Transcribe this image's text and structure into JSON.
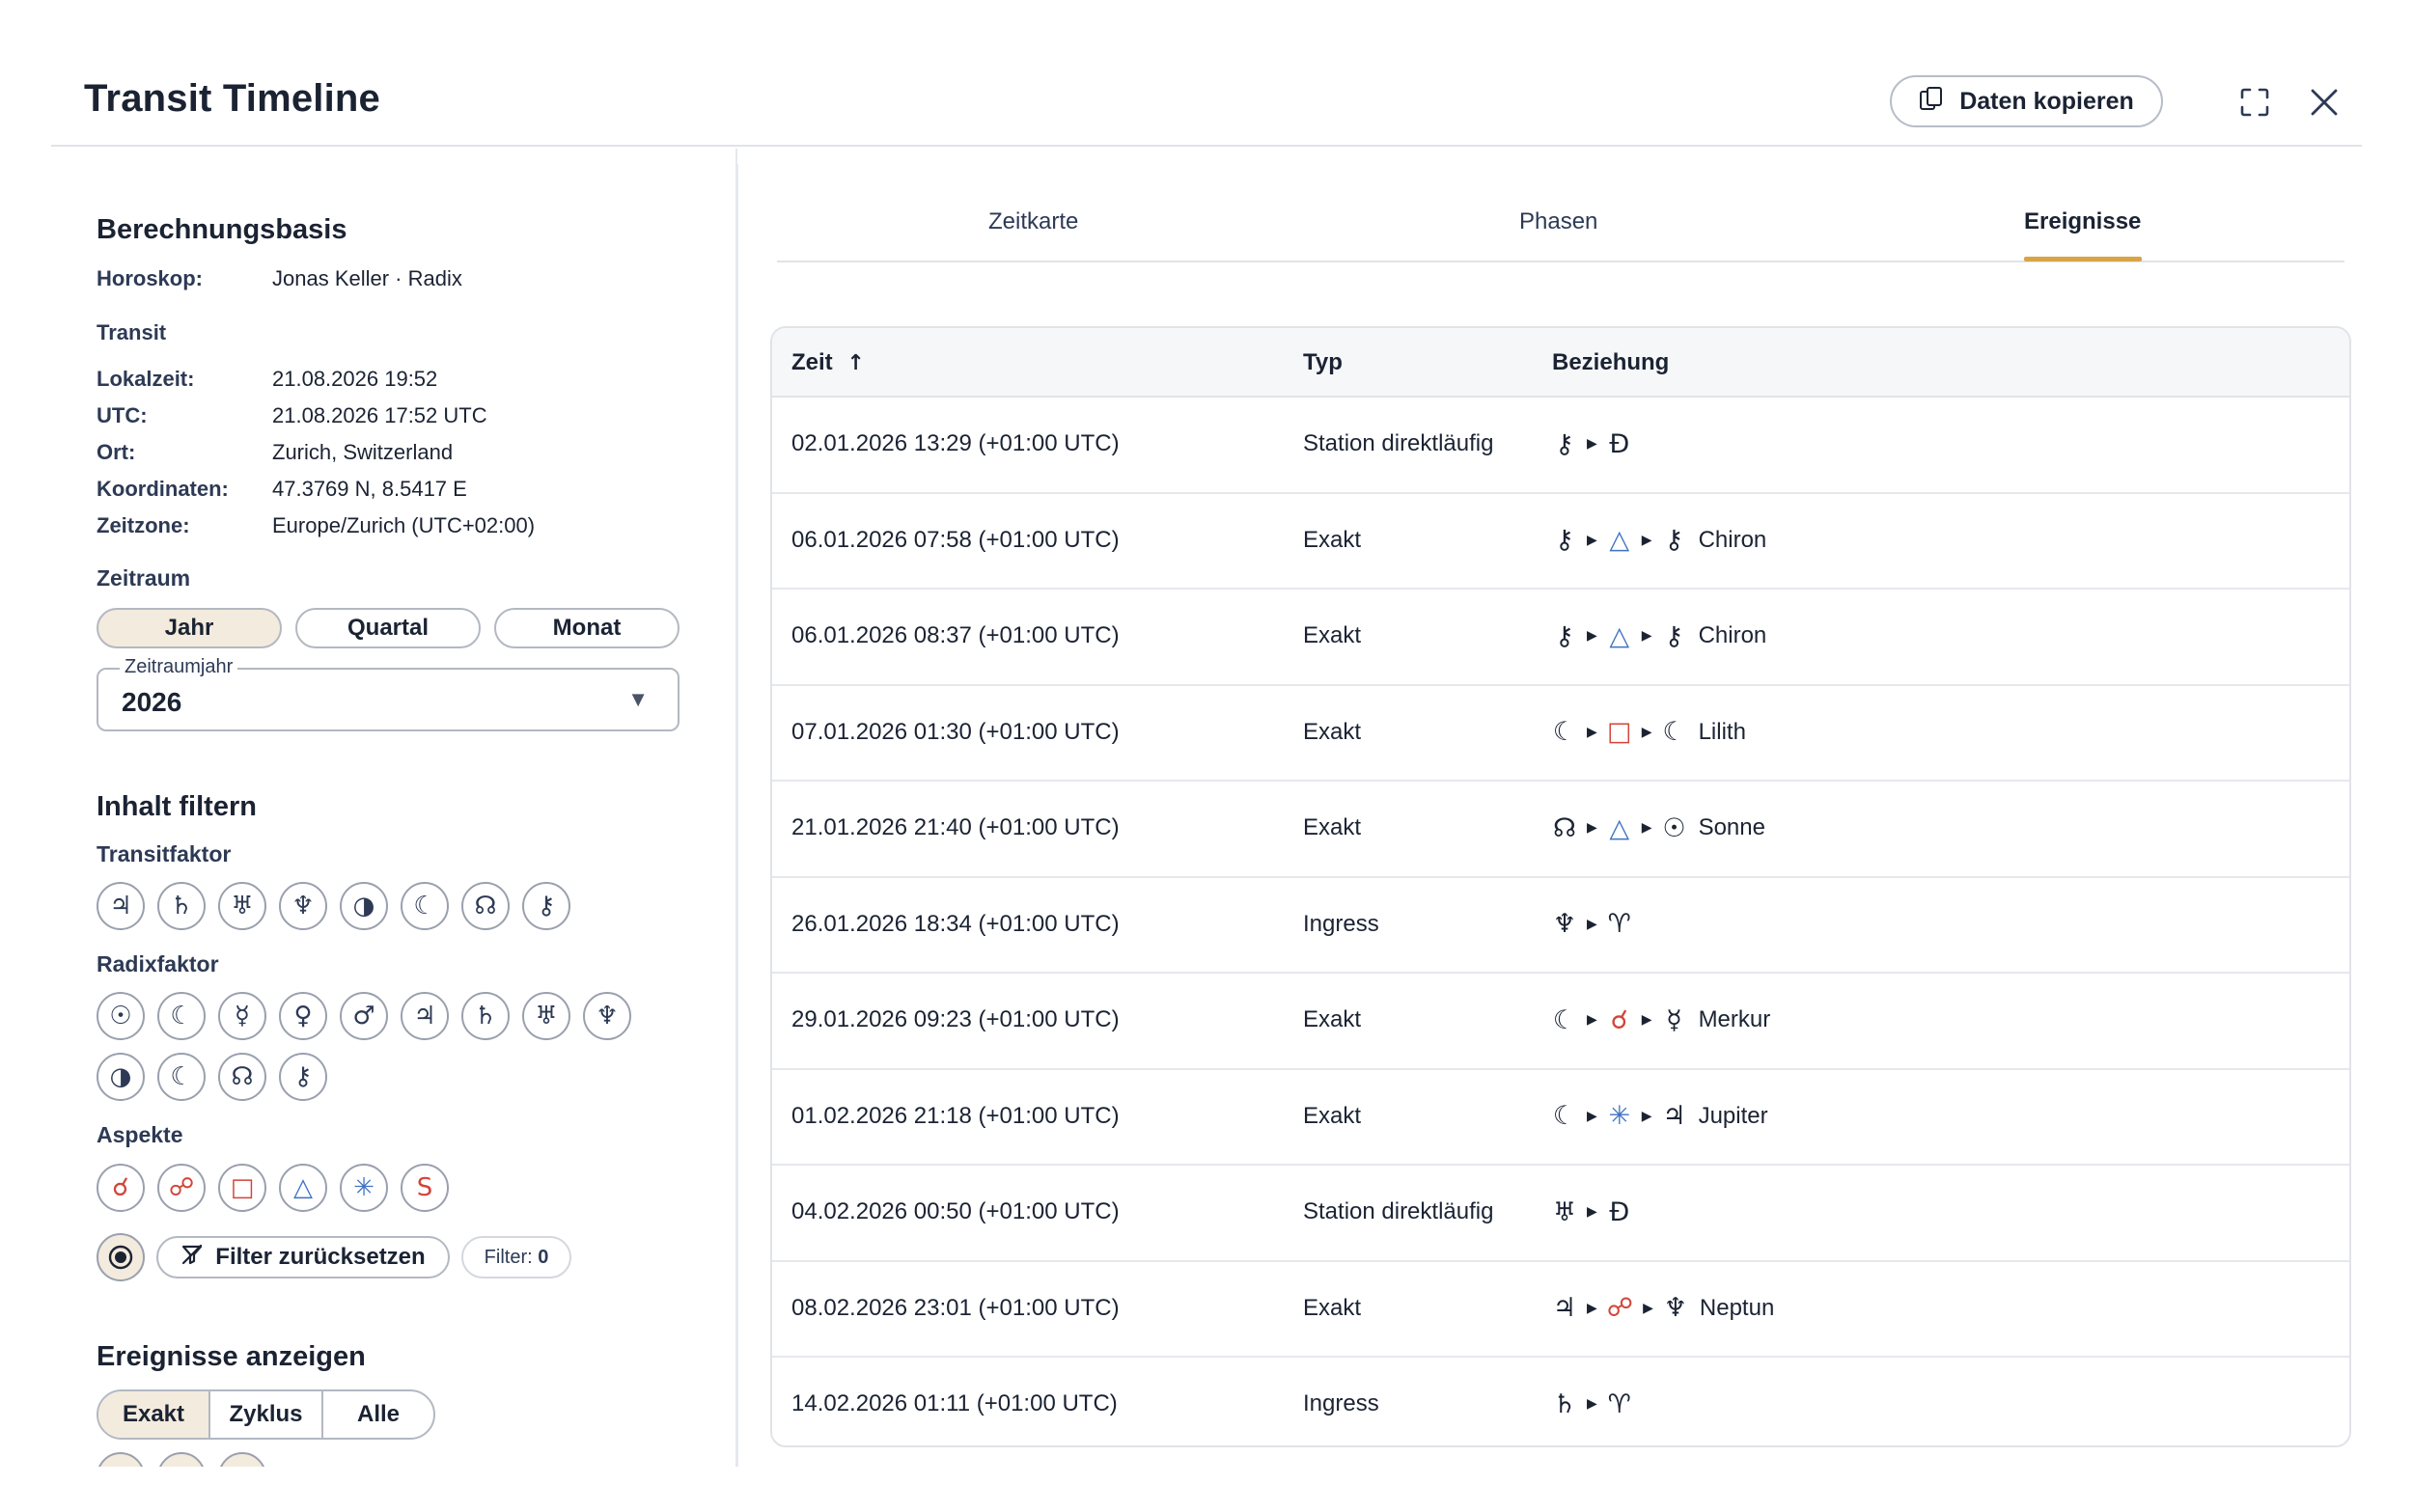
{
  "header": {
    "title": "Transit Timeline",
    "copy_label": "Daten kopieren"
  },
  "basis": {
    "title": "Berechnungsbasis",
    "horoskop_label": "Horoskop:",
    "horoskop_value": "Jonas Keller · Radix",
    "transit_title": "Transit",
    "rows": [
      {
        "label": "Lokalzeit:",
        "value": "21.08.2026 19:52"
      },
      {
        "label": "UTC:",
        "value": "21.08.2026 17:52 UTC"
      },
      {
        "label": "Ort:",
        "value": "Zurich, Switzerland"
      },
      {
        "label": "Koordinaten:",
        "value": "47.3769 N, 8.5417 E"
      },
      {
        "label": "Zeitzone:",
        "value": "Europe/Zurich (UTC+02:00)"
      }
    ]
  },
  "zeitraum": {
    "title": "Zeitraum",
    "options": [
      "Jahr",
      "Quartal",
      "Monat"
    ],
    "selected": "Jahr",
    "select_label": "Zeitraumjahr",
    "select_value": "2026"
  },
  "filter": {
    "title": "Inhalt filtern",
    "transit_title": "Transitfaktor",
    "transit_chips": [
      "♃",
      "♄",
      "♅",
      "♆",
      "◑",
      "☾",
      "☊",
      "⚷"
    ],
    "radix_title": "Radixfaktor",
    "radix_chips": [
      "☉",
      "☾",
      "☿",
      "♀",
      "♂",
      "♃",
      "♄",
      "♅",
      "♆",
      "◑",
      "☾",
      "☊",
      "⚷"
    ],
    "aspects_title": "Aspekte",
    "aspect_chips": [
      "☌",
      "☍",
      "□",
      "△",
      "✳",
      "S"
    ],
    "reset_label": "Filter zurücksetzen",
    "count_label": "Filter:",
    "count_value": "0"
  },
  "events": {
    "title": "Ereignisse anzeigen",
    "options": [
      "Exakt",
      "Zyklus",
      "Alle"
    ],
    "selected": "Exakt"
  },
  "tabs": [
    "Zeitkarte",
    "Phasen",
    "Ereignisse"
  ],
  "active_tab": "Ereignisse",
  "table": {
    "columns": [
      "Zeit",
      "Typ",
      "Beziehung"
    ],
    "sort_indicator": "↑",
    "rows": [
      {
        "time": "02.01.2026 13:29 (+01:00 UTC)",
        "type": "Station direktläufig",
        "rel": [
          {
            "g": "⚷",
            "c": ""
          },
          {
            "g": "Đ",
            "c": ""
          }
        ]
      },
      {
        "time": "06.01.2026 07:58 (+01:00 UTC)",
        "type": "Exakt",
        "rel": [
          {
            "g": "⚷",
            "c": ""
          },
          {
            "g": "△",
            "c": "blue"
          },
          {
            "g": "⚷",
            "c": ""
          }
        ],
        "target": "Chiron"
      },
      {
        "time": "06.01.2026 08:37 (+01:00 UTC)",
        "type": "Exakt",
        "rel": [
          {
            "g": "⚷",
            "c": ""
          },
          {
            "g": "△",
            "c": "blue"
          },
          {
            "g": "⚷",
            "c": ""
          }
        ],
        "target": "Chiron"
      },
      {
        "time": "07.01.2026 01:30 (+01:00 UTC)",
        "type": "Exakt",
        "rel": [
          {
            "g": "☾",
            "c": ""
          },
          {
            "g": "□",
            "c": "red"
          },
          {
            "g": "☾",
            "c": ""
          }
        ],
        "target": "Lilith"
      },
      {
        "time": "21.01.2026 21:40 (+01:00 UTC)",
        "type": "Exakt",
        "rel": [
          {
            "g": "☊",
            "c": ""
          },
          {
            "g": "△",
            "c": "blue"
          },
          {
            "g": "☉",
            "c": ""
          }
        ],
        "target": "Sonne"
      },
      {
        "time": "26.01.2026 18:34 (+01:00 UTC)",
        "type": "Ingress",
        "rel": [
          {
            "g": "♆",
            "c": ""
          },
          {
            "g": "♈",
            "c": ""
          }
        ]
      },
      {
        "time": "29.01.2026 09:23 (+01:00 UTC)",
        "type": "Exakt",
        "rel": [
          {
            "g": "☾",
            "c": ""
          },
          {
            "g": "☌",
            "c": "red"
          },
          {
            "g": "☿",
            "c": ""
          }
        ],
        "target": "Merkur"
      },
      {
        "time": "01.02.2026 21:18 (+01:00 UTC)",
        "type": "Exakt",
        "rel": [
          {
            "g": "☾",
            "c": ""
          },
          {
            "g": "✳",
            "c": "blue"
          },
          {
            "g": "♃",
            "c": ""
          }
        ],
        "target": "Jupiter"
      },
      {
        "time": "04.02.2026 00:50 (+01:00 UTC)",
        "type": "Station direktläufig",
        "rel": [
          {
            "g": "♅",
            "c": ""
          },
          {
            "g": "Đ",
            "c": ""
          }
        ]
      },
      {
        "time": "08.02.2026 23:01 (+01:00 UTC)",
        "type": "Exakt",
        "rel": [
          {
            "g": "♃",
            "c": ""
          },
          {
            "g": "☍",
            "c": "red"
          },
          {
            "g": "♆",
            "c": ""
          }
        ],
        "target": "Neptun"
      },
      {
        "time": "14.02.2026 01:11 (+01:00 UTC)",
        "type": "Ingress",
        "rel": [
          {
            "g": "♄",
            "c": ""
          },
          {
            "g": "♈",
            "c": ""
          }
        ]
      }
    ]
  },
  "colors": {
    "accent": "#d9a445",
    "selected_bg": "#f3ebdd",
    "aspect_red": "#d2453a",
    "aspect_blue": "#3f72c4"
  }
}
